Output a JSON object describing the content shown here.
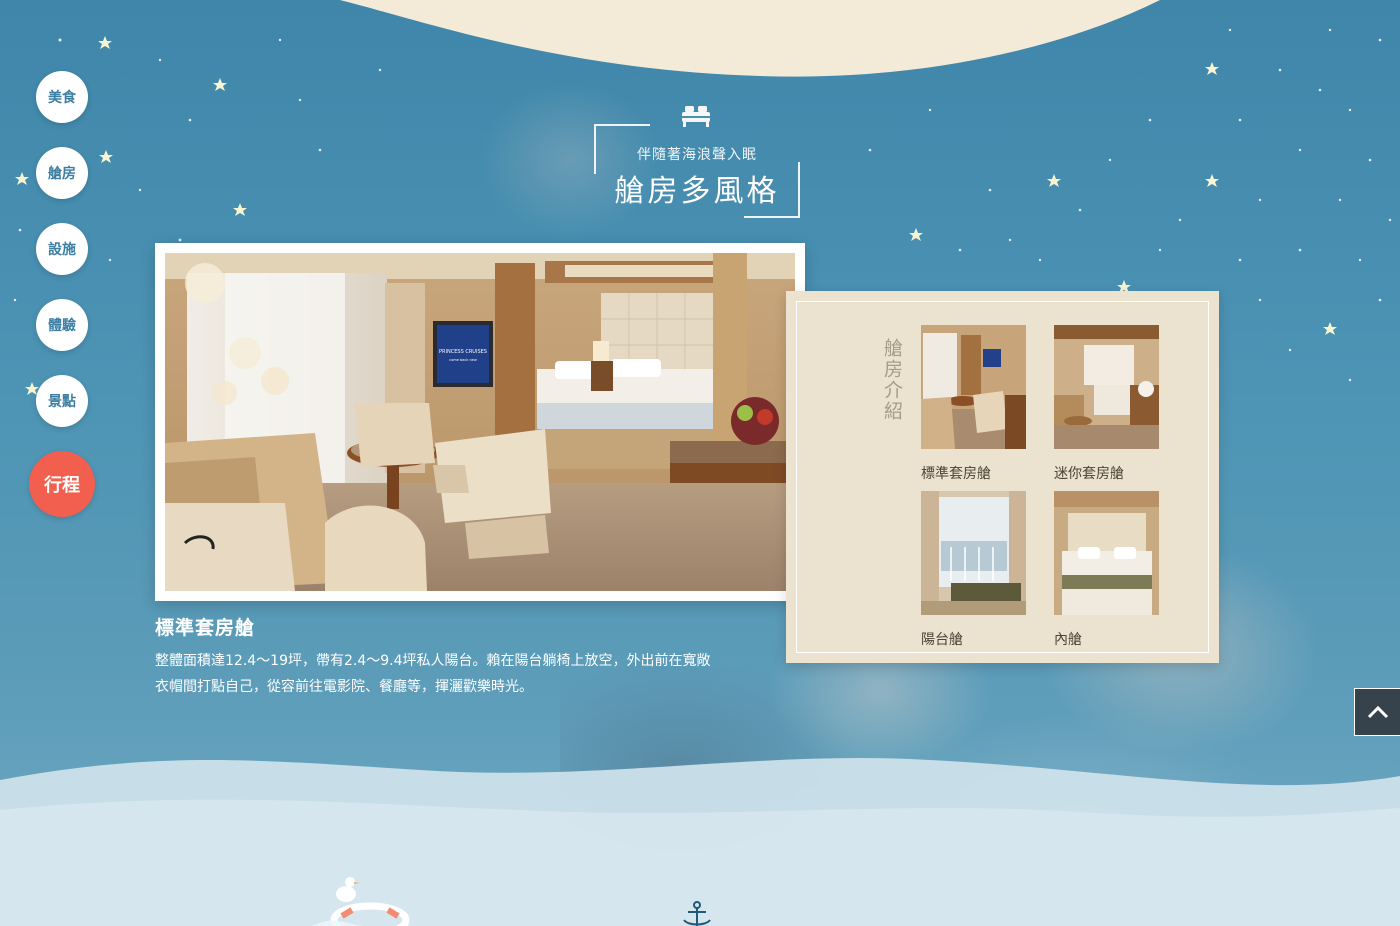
{
  "side_nav": {
    "items": [
      {
        "label": "美食",
        "active": false
      },
      {
        "label": "艙房",
        "active": false
      },
      {
        "label": "設施",
        "active": false
      },
      {
        "label": "體驗",
        "active": false
      },
      {
        "label": "景點",
        "active": false
      },
      {
        "label": "行程",
        "active": true
      }
    ]
  },
  "section": {
    "icon": "bed-icon",
    "subtitle": "伴隨著海浪聲入眠",
    "title": "艙房多風格"
  },
  "main_photo": {
    "tv_brand": "PRINCESS CRUISES",
    "tv_tagline": "come back new"
  },
  "room": {
    "title": "標準套房艙",
    "description_line1": "整體面積達12.4～19坪，帶有2.4～9.4坪私人陽台。賴在陽台躺椅上放空，外出前在寬敞",
    "description_line2": "衣帽間打點自己，從容前往電影院、餐廳等，揮灑歡樂時光。"
  },
  "intro_panel": {
    "label": "艙房介紹",
    "cabins": [
      {
        "name": "標準套房艙"
      },
      {
        "name": "迷你套房艙"
      },
      {
        "name": "陽台艙"
      },
      {
        "name": "內艙"
      }
    ]
  },
  "colors": {
    "sea_blue": "#4a8fb0",
    "cream": "#f4ead8",
    "accent_red": "#f25f4f",
    "panel_beige": "#ebe2cf",
    "back_top_dark": "#36424c"
  },
  "icons": {
    "back_to_top": "chevron-up-icon",
    "decor_left": "seagull-float-ring-icon",
    "decor_center": "anchor-icon"
  }
}
